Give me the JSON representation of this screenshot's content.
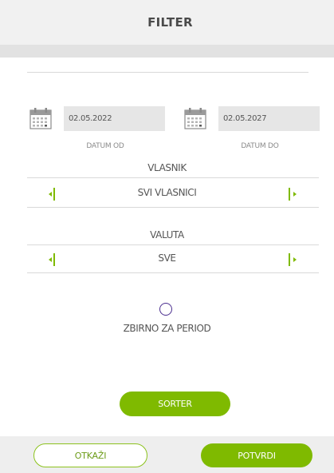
{
  "header": {
    "title": "FILTER"
  },
  "date_range": {
    "from": {
      "value": "02.05.2022",
      "label": "DATUM OD",
      "icon": "calendar-icon"
    },
    "to": {
      "value": "02.05.2027",
      "label": "DATUM DO",
      "icon": "calendar-icon"
    }
  },
  "owner": {
    "title": "VLASNIK",
    "value": "SVI VLASNICI"
  },
  "currency": {
    "title": "VALUTA",
    "value": "SVE"
  },
  "summary": {
    "label": "ZBIRNO ZA PERIOD",
    "checked": false
  },
  "sorter_button": {
    "label": "SORTER"
  },
  "footer": {
    "cancel_label": "OTKAŽI",
    "confirm_label": "POTVRDI"
  },
  "colors": {
    "accent": "#7fba00",
    "radio": "#4b2f8f"
  }
}
